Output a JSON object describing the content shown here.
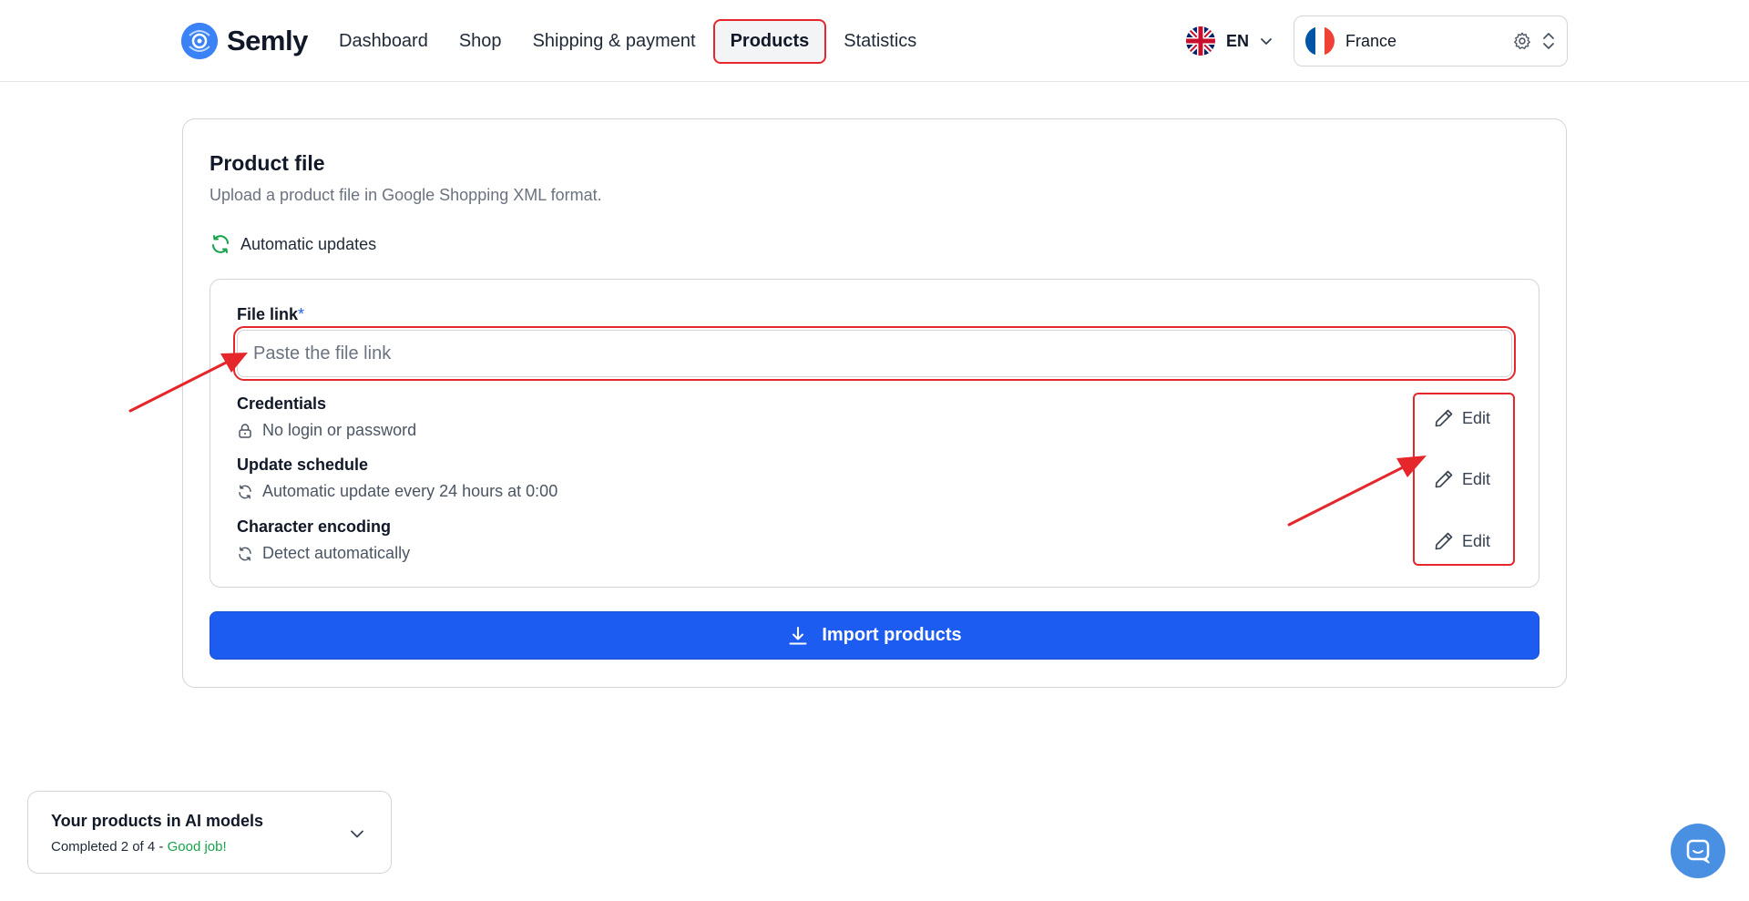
{
  "header": {
    "brand": "Semly",
    "nav": [
      {
        "label": "Dashboard",
        "active": false
      },
      {
        "label": "Shop",
        "active": false
      },
      {
        "label": "Shipping & payment",
        "active": false
      },
      {
        "label": "Products",
        "active": true
      },
      {
        "label": "Statistics",
        "active": false
      }
    ],
    "language": {
      "code": "EN",
      "flag": "uk-flag-icon"
    },
    "country": {
      "name": "France",
      "flag": "france-flag-icon"
    }
  },
  "product_file": {
    "title": "Product file",
    "subtitle": "Upload a product file in Google Shopping XML format.",
    "auto_updates_label": "Automatic updates",
    "file_link": {
      "label": "File link",
      "required_mark": "*",
      "placeholder": "Paste the file link",
      "value": ""
    },
    "settings": [
      {
        "name": "Credentials",
        "value": "No login or password",
        "icon": "lock-icon",
        "edit_label": "Edit"
      },
      {
        "name": "Update schedule",
        "value": "Automatic update every 24 hours at 0:00",
        "icon": "refresh-icon",
        "edit_label": "Edit"
      },
      {
        "name": "Character encoding",
        "value": "Detect automatically",
        "icon": "refresh-icon",
        "edit_label": "Edit"
      }
    ],
    "import_button": "Import products"
  },
  "ai_progress": {
    "title": "Your products in AI models",
    "status": "Completed 2 of 4",
    "separator": " - ",
    "praise": "Good job!"
  },
  "colors": {
    "accent": "#1d5cf0",
    "annotation": "#e5262b",
    "success": "#16a34a"
  }
}
